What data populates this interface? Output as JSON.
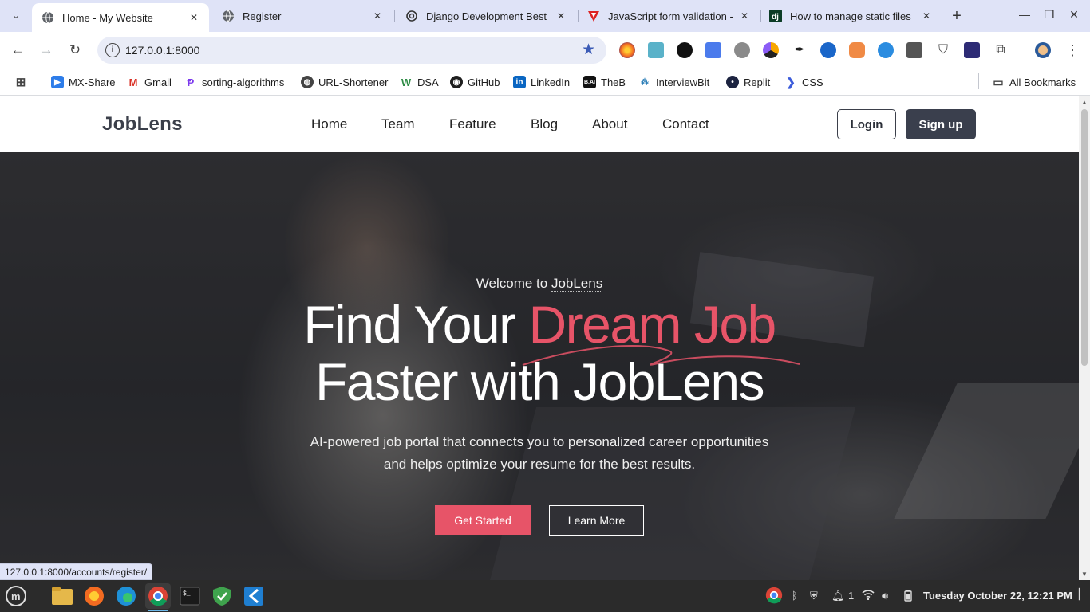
{
  "browser": {
    "tabs": [
      {
        "title": "Home - My Website",
        "active": true
      },
      {
        "title": "Register",
        "active": false
      },
      {
        "title": "Django Development Best",
        "active": false
      },
      {
        "title": "JavaScript form validation -",
        "active": false
      },
      {
        "title": "How to manage static files",
        "active": false
      }
    ],
    "url": "127.0.0.1:8000",
    "extension_badge": "19",
    "bookmarks": [
      "MX-Share",
      "Gmail",
      "sorting-algorithms",
      "URL-Shortener",
      "DSA",
      "GitHub",
      "LinkedIn",
      "TheB",
      "InterviewBit",
      "Replit",
      "CSS"
    ],
    "all_bookmarks": "All Bookmarks",
    "status_url": "127.0.0.1:8000/accounts/register/"
  },
  "site": {
    "brand": "JobLens",
    "nav": [
      "Home",
      "Team",
      "Feature",
      "Blog",
      "About",
      "Contact"
    ],
    "login": "Login",
    "signup": "Sign up"
  },
  "hero": {
    "welcome_prefix": "Welcome to ",
    "welcome_brand": "JobLens",
    "headline_line1_a": "Find Your ",
    "headline_line1_b": "Dream Job",
    "headline_line2": "Faster with JobLens",
    "sub_line1": "AI-powered job portal that connects you to personalized career opportunities",
    "sub_line2": "and helps optimize your resume for the best results.",
    "cta_primary": "Get Started",
    "cta_secondary": "Learn More",
    "accent_color": "#e75468"
  },
  "taskbar": {
    "notification_count": "1",
    "clock": "Tuesday October 22, 12:21 PM"
  }
}
